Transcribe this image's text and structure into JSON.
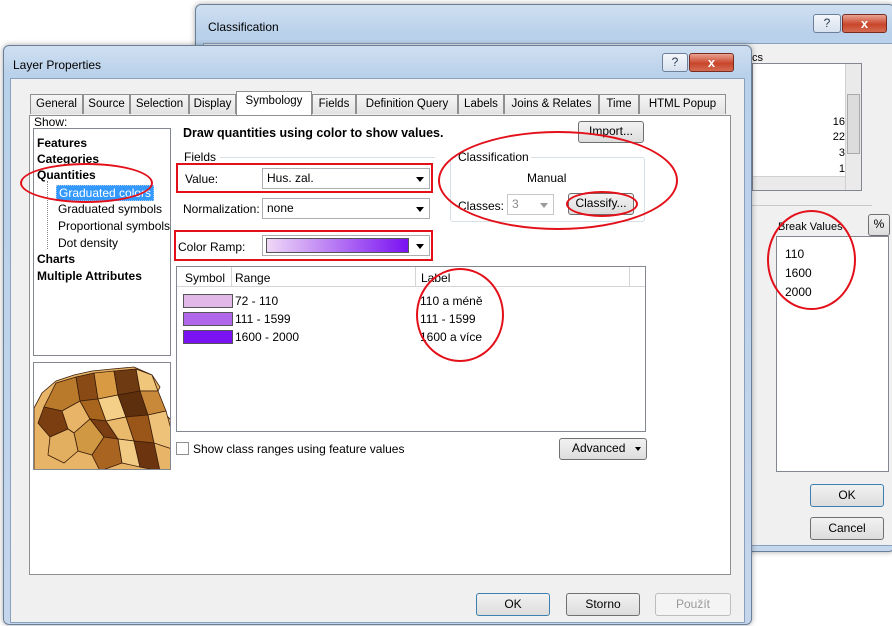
{
  "classification_dialog": {
    "title": "Classification",
    "help": "?",
    "close": "x",
    "stats_fragment": "cs",
    "stats_values": [
      "16",
      "22",
      "3",
      "1"
    ],
    "break_values_header": "Break Values",
    "percent_button": "%",
    "break_values": [
      "110",
      "1600",
      "2000"
    ],
    "ok": "OK",
    "cancel": "Cancel"
  },
  "layer_properties": {
    "title": "Layer Properties",
    "help": "?",
    "close": "x",
    "tabs": [
      "General",
      "Source",
      "Selection",
      "Display",
      "Symbology",
      "Fields",
      "Definition Query",
      "Labels",
      "Joins & Relates",
      "Time",
      "HTML Popup"
    ],
    "active_tab": "Symbology",
    "show_label": "Show:",
    "tree": {
      "features": "Features",
      "categories": "Categories",
      "quantities": "Quantities",
      "graduated_colors": "Graduated colors",
      "graduated_symbols": "Graduated symbols",
      "proportional_symbols": "Proportional symbols",
      "dot_density": "Dot density",
      "charts": "Charts",
      "multiple_attributes": "Multiple Attributes"
    },
    "heading": "Draw quantities using color to show values.",
    "import_button": "Import...",
    "fields_group": "Fields",
    "value_label": "Value:",
    "value_field": "Hus. zal.",
    "normalization_label": "Normalization:",
    "normalization_value": "none",
    "classification_group": "Classification",
    "method": "Manual",
    "classes_label": "Classes:",
    "classes_value": "3",
    "classify_button": "Classify...",
    "color_ramp_label": "Color Ramp:",
    "table_headers": {
      "symbol": "Symbol",
      "range": "Range",
      "label": "Label"
    },
    "rows": [
      {
        "color": "#e2b8e8",
        "range": "72 - 110",
        "label": "110 a méně"
      },
      {
        "color": "#b167ea",
        "range": "111 - 1599",
        "label": "111 - 1599"
      },
      {
        "color": "#7a12f2",
        "range": "1600 - 2000",
        "label": "1600 a více"
      }
    ],
    "show_ranges_checkbox": "Show class ranges using feature values",
    "advanced_button": "Advanced",
    "ok": "OK",
    "storno": "Storno",
    "apply": "Použít"
  },
  "colors": {
    "highlight": "#e3101a",
    "selection": "#3399ff",
    "ramp_start": "#efd8f6",
    "ramp_end": "#7a12f2"
  }
}
